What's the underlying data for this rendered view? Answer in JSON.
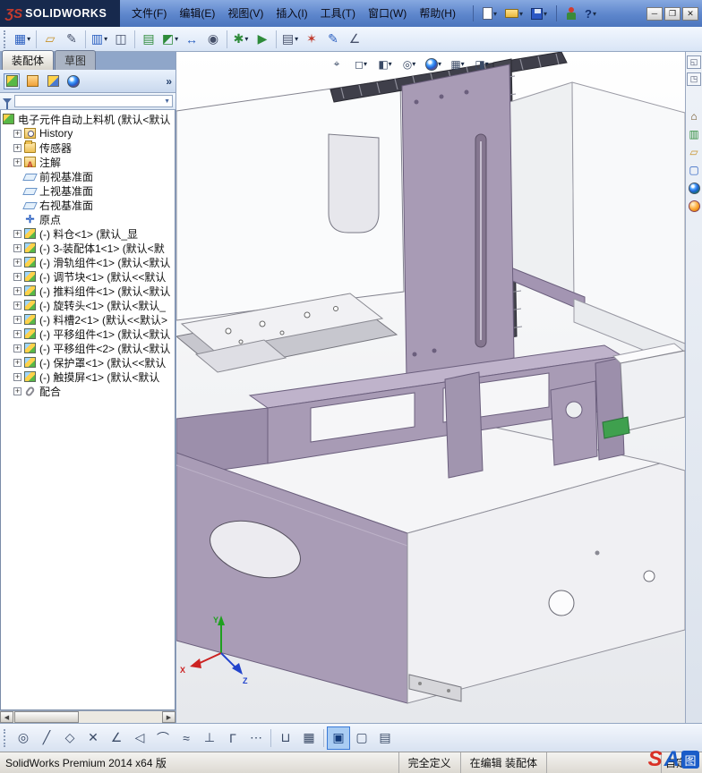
{
  "app": {
    "logo_mark": "ƷS",
    "logo_text": "SOLIDWORKS"
  },
  "menubar": {
    "items": [
      "文件(F)",
      "编辑(E)",
      "视图(V)",
      "插入(I)",
      "工具(T)",
      "窗口(W)",
      "帮助(H)"
    ]
  },
  "window_controls": {
    "minimize": "─",
    "maximize": "❐",
    "close": "✕"
  },
  "glyphs": {
    "caret": "▾",
    "plus": "+",
    "overflow": "»",
    "filter_caret": "▼",
    "left_arrow": "◀",
    "right_arrow": "▶",
    "annotation_a": "A",
    "origin": "✛"
  },
  "colors": {
    "part_lavender": "#a89bb5",
    "part_white": "#f5f5f7",
    "triad_x": "#cc2222",
    "triad_y": "#1fa01f",
    "triad_z": "#2244cc",
    "titlebar_blue": "#5d86cc",
    "logo_navy": "#17294d",
    "highlight_blue": "#a9ccf3"
  },
  "toolbars": {
    "quick": {
      "help": "?"
    },
    "assembly": {
      "icons": [
        {
          "name": "layout-grid-icon",
          "glyph": "▦"
        },
        {
          "name": "open-folder-icon",
          "glyph": "▱"
        },
        {
          "name": "edit-component-icon",
          "glyph": "✎"
        },
        {
          "name": "columns-icon",
          "glyph": "▥"
        },
        {
          "name": "compare-documents-icon",
          "glyph": "◫"
        },
        {
          "name": "design-table-icon",
          "glyph": "▤"
        },
        {
          "name": "insert-component-icon",
          "glyph": "◩"
        },
        {
          "name": "mate-icon",
          "glyph": "↔"
        },
        {
          "name": "show-hide-icon",
          "glyph": "◉"
        },
        {
          "name": "assembly-features-icon",
          "glyph": "✱"
        },
        {
          "name": "motion-study-icon",
          "glyph": "▶"
        },
        {
          "name": "bom-icon",
          "glyph": "▤"
        },
        {
          "name": "exploded-view-icon",
          "glyph": "✶"
        },
        {
          "name": "sketch-icon",
          "glyph": "✎"
        },
        {
          "name": "measure-icon",
          "glyph": "∠"
        }
      ]
    },
    "headsup": {
      "icons": [
        {
          "name": "zoom-fit-icon",
          "glyph": "⌖"
        },
        {
          "name": "view-orientation-icon",
          "glyph": "◻"
        },
        {
          "name": "display-style-icon",
          "glyph": "◧"
        },
        {
          "name": "hide-show-items-icon",
          "glyph": "◎"
        },
        {
          "name": "edit-appearance-icon",
          "glyph": "◉"
        },
        {
          "name": "apply-scene-icon",
          "glyph": "▦"
        },
        {
          "name": "view-settings-icon",
          "glyph": "◨"
        }
      ]
    },
    "sketch": {
      "icons": [
        {
          "name": "smart-dimension-icon",
          "glyph": "◎"
        },
        {
          "name": "line-icon",
          "glyph": "╱"
        },
        {
          "name": "rectangle-icon",
          "glyph": "◇"
        },
        {
          "name": "delete-icon",
          "glyph": "✕"
        },
        {
          "name": "angle-icon",
          "glyph": "∠"
        },
        {
          "name": "arrow-icon",
          "glyph": "◁"
        },
        {
          "name": "arc-icon",
          "glyph": "⌒"
        },
        {
          "name": "spline-icon",
          "glyph": "≈"
        },
        {
          "name": "perpendicular-icon",
          "glyph": "⊥"
        },
        {
          "name": "corner-icon",
          "glyph": "Γ"
        },
        {
          "name": "more-icon",
          "glyph": "⋯"
        },
        {
          "name": "slot-icon",
          "glyph": "⊔"
        },
        {
          "name": "grid-icon",
          "glyph": "▦"
        },
        {
          "name": "window-pane-icon",
          "glyph": "▣"
        },
        {
          "name": "pane-outline-icon",
          "glyph": "▢"
        },
        {
          "name": "list-view-icon",
          "glyph": "▤"
        }
      ]
    },
    "right_top": [
      {
        "name": "collapse-panel-icon",
        "glyph": "◱"
      },
      {
        "name": "restore-panel-icon",
        "glyph": "◳"
      }
    ],
    "right": {
      "icons": [
        {
          "name": "home-icon",
          "glyph": "⌂"
        },
        {
          "name": "stats-icon",
          "glyph": "▥"
        },
        {
          "name": "folder-icon",
          "glyph": "▱"
        },
        {
          "name": "panel-icon",
          "glyph": "▢"
        },
        {
          "name": "appearance-sphere-icon",
          "glyph": ""
        },
        {
          "name": "scene-sphere-icon",
          "glyph": ""
        }
      ]
    }
  },
  "panel": {
    "tabs": {
      "assembly": "装配体",
      "sketch": "草图"
    },
    "header_icons": [
      "featuremanager-tree-icon",
      "propertymanager-icon",
      "configurationmanager-icon",
      "appearances-icon"
    ]
  },
  "tree": {
    "root": "电子元件自动上料机  (默认<默认",
    "items": [
      {
        "label": "History"
      },
      {
        "label": "传感器"
      },
      {
        "label": "注解"
      },
      {
        "label": "前视基准面"
      },
      {
        "label": "上视基准面"
      },
      {
        "label": "右视基准面"
      },
      {
        "label": "原点"
      },
      {
        "label": "(-) 料仓<1> (默认_显"
      },
      {
        "label": "(-) 3-装配体1<1> (默认<默"
      },
      {
        "label": "(-) 滑轨组件<1> (默认<默认"
      },
      {
        "label": "(-) 调节块<1> (默认<<默认"
      },
      {
        "label": "(-) 推料组件<1> (默认<默认"
      },
      {
        "label": "(-) 旋转头<1> (默认<默认_"
      },
      {
        "label": "(-) 料槽2<1> (默认<<默认>"
      },
      {
        "label": "(-) 平移组件<1> (默认<默认"
      },
      {
        "label": "(-) 平移组件<2> (默认<默认"
      },
      {
        "label": "(-) 保护罩<1> (默认<<默认"
      },
      {
        "label": "(-) 触摸屏<1> (默认<默认"
      },
      {
        "label": "配合"
      }
    ]
  },
  "triad": {
    "x": "X",
    "y": "Y",
    "z": "Z"
  },
  "statusbar": {
    "product": "SolidWorks Premium 2014 x64 版",
    "defined": "完全定义",
    "editing": "在编辑 装配体",
    "custom": "自定..."
  },
  "watermark": {
    "s": "S",
    "a": "A",
    "cn": "图"
  }
}
